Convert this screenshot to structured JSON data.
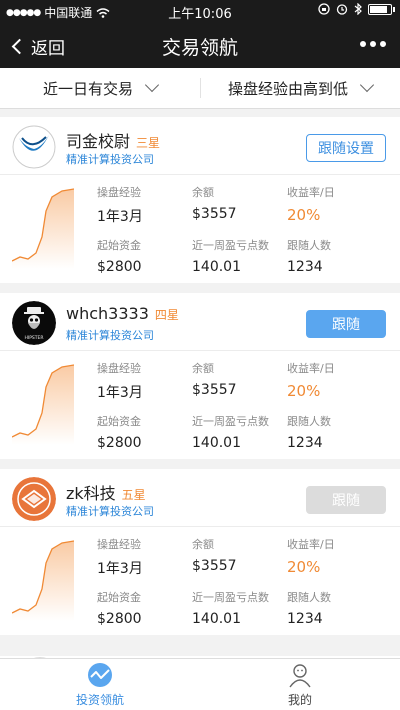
{
  "status_bar": {
    "carrier": "中国联通",
    "time": "上午10:06"
  },
  "nav": {
    "back_label": "返回",
    "title": "交易领航"
  },
  "filters": [
    {
      "label": "近一日有交易"
    },
    {
      "label": "操盘经验由高到低"
    }
  ],
  "labels": {
    "experience": "操盘经验",
    "balance": "余额",
    "return_rate": "收益率/日",
    "initial_funds": "起始资金",
    "weekly_points": "近一周盈亏点数",
    "followers": "跟随人数"
  },
  "traders": [
    {
      "name": "司金校尉",
      "star": "三星",
      "company": "精准计算投资公司",
      "button": "跟随设置",
      "button_state": "outline",
      "experience": "1年3月",
      "balance": "$3557",
      "return_rate": "20%",
      "initial_funds": "$2800",
      "weekly_points": "140.01",
      "followers": "1234"
    },
    {
      "name": "whch3333",
      "star": "四星",
      "company": "精准计算投资公司",
      "avatar_text": "HIPSTER",
      "button": "跟随",
      "button_state": "solid",
      "experience": "1年3月",
      "balance": "$3557",
      "return_rate": "20%",
      "initial_funds": "$2800",
      "weekly_points": "140.01",
      "followers": "1234"
    },
    {
      "name": "zk科技",
      "star": "五星",
      "company": "精准计算投资公司",
      "button": "跟随",
      "button_state": "disabled",
      "experience": "1年3月",
      "balance": "$3557",
      "return_rate": "20%",
      "initial_funds": "$2800",
      "weekly_points": "140.01",
      "followers": "1234"
    }
  ],
  "tabs": [
    {
      "label": "投资领航",
      "icon": "wave-icon",
      "active": true
    },
    {
      "label": "我的",
      "icon": "user-icon",
      "active": false
    }
  ],
  "colors": {
    "accent": "#3a8ee0",
    "orange": "#f08a35",
    "bar": "#1b1b1b"
  }
}
